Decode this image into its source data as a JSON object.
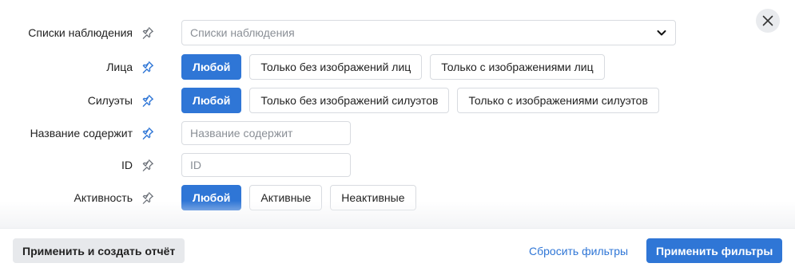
{
  "close_icon": "close-icon",
  "colors": {
    "accent": "#2f76d6",
    "pin_pinned": "#2f76d6",
    "pin_unpinned": "#6b7078"
  },
  "filters": {
    "watchlists": {
      "label": "Списки наблюдения",
      "pinned": false,
      "placeholder": "Списки наблюдения"
    },
    "faces": {
      "label": "Лица",
      "pinned": true,
      "options": [
        "Любой",
        "Только без изображений лиц",
        "Только с изображениями лиц"
      ],
      "selected": "Любой"
    },
    "silhouettes": {
      "label": "Силуэты",
      "pinned": true,
      "options": [
        "Любой",
        "Только без изображений силуэтов",
        "Только с изображениями силуэтов"
      ],
      "selected": "Любой"
    },
    "name_contains": {
      "label": "Название содержит",
      "pinned": true,
      "placeholder": "Название содержит",
      "value": ""
    },
    "id": {
      "label": "ID",
      "pinned": false,
      "placeholder": "ID",
      "value": ""
    },
    "activity": {
      "label": "Активность",
      "pinned": false,
      "options": [
        "Любой",
        "Активные",
        "Неактивные"
      ],
      "selected": "Любой"
    }
  },
  "footer": {
    "apply_and_report": "Применить и создать отчёт",
    "reset": "Сбросить фильтры",
    "apply": "Применить фильтры"
  }
}
